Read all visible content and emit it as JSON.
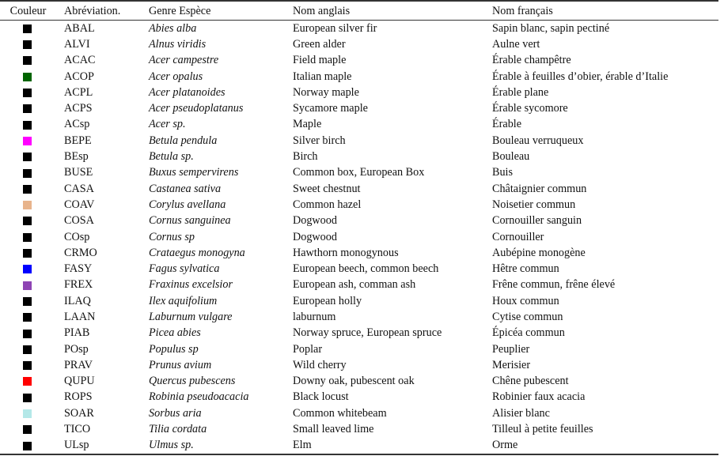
{
  "headers": {
    "color": "Couleur",
    "abbreviation": "Abréviation.",
    "genus_species": "Genre Espèce",
    "english_name": "Nom anglais",
    "french_name": "Nom français"
  },
  "rows": [
    {
      "color": "#000000",
      "abbr": "ABAL",
      "genus": "Abies alba",
      "en": "European silver fir",
      "fr": "Sapin blanc, sapin pectiné"
    },
    {
      "color": "#000000",
      "abbr": "ALVI",
      "genus": "Alnus viridis",
      "en": "Green alder",
      "fr": "Aulne vert"
    },
    {
      "color": "#000000",
      "abbr": "ACAC",
      "genus": "Acer campestre",
      "en": "Field maple",
      "fr": "Érable champêtre"
    },
    {
      "color": "#006400",
      "abbr": "ACOP",
      "genus": "Acer opalus",
      "en": "Italian maple",
      "fr": "Érable à feuilles d’obier, érable d’Italie"
    },
    {
      "color": "#000000",
      "abbr": "ACPL",
      "genus": "Acer platanoides",
      "en": "Norway maple",
      "fr": "Érable plane"
    },
    {
      "color": "#000000",
      "abbr": "ACPS",
      "genus": "Acer pseudoplatanus",
      "en": "Sycamore maple",
      "fr": "Érable sycomore"
    },
    {
      "color": "#000000",
      "abbr": "ACsp",
      "genus": "Acer sp.",
      "en": "Maple",
      "fr": "Érable"
    },
    {
      "color": "#ff00ff",
      "abbr": "BEPE",
      "genus": "Betula pendula",
      "en": "Silver birch",
      "fr": "Bouleau verruqueux"
    },
    {
      "color": "#000000",
      "abbr": "BEsp",
      "genus": "Betula sp.",
      "en": "Birch",
      "fr": "Bouleau"
    },
    {
      "color": "#000000",
      "abbr": "BUSE",
      "genus": "Buxus sempervirens",
      "en": "Common box, European Box",
      "fr": "Buis"
    },
    {
      "color": "#000000",
      "abbr": "CASA",
      "genus": "Castanea sativa",
      "en": "Sweet chestnut",
      "fr": "Châtaignier commun"
    },
    {
      "color": "#e8b48c",
      "abbr": "COAV",
      "genus": "Corylus avellana",
      "en": "Common hazel",
      "fr": "Noisetier commun"
    },
    {
      "color": "#000000",
      "abbr": "COSA",
      "genus": "Cornus sanguinea",
      "en": "Dogwood",
      "fr": "Cornouiller sanguin"
    },
    {
      "color": "#000000",
      "abbr": "COsp",
      "genus": "Cornus sp",
      "en": "Dogwood",
      "fr": "Cornouiller"
    },
    {
      "color": "#000000",
      "abbr": "CRMO",
      "genus": "Crataegus monogyna",
      "en": "Hawthorn monogynous",
      "fr": "Aubépine monogène"
    },
    {
      "color": "#0000ff",
      "abbr": "FASY",
      "genus": "Fagus sylvatica",
      "en": "European beech, common beech",
      "fr": "Hêtre commun"
    },
    {
      "color": "#8e44b4",
      "abbr": "FREX",
      "genus": "Fraxinus excelsior",
      "en": "European ash, comman ash",
      "fr": "Frêne commun, frêne élevé"
    },
    {
      "color": "#000000",
      "abbr": "ILAQ",
      "genus": "Ilex aquifolium",
      "en": "European holly",
      "fr": "Houx commun"
    },
    {
      "color": "#000000",
      "abbr": "LAAN",
      "genus": "Laburnum vulgare",
      "en": "laburnum",
      "fr": "Cytise commun"
    },
    {
      "color": "#000000",
      "abbr": "PIAB",
      "genus": "Picea abies",
      "en": "Norway spruce, European spruce",
      "fr": "Épicéa commun"
    },
    {
      "color": "#000000",
      "abbr": "POsp",
      "genus": "Populus sp",
      "en": "Poplar",
      "fr": "Peuplier"
    },
    {
      "color": "#000000",
      "abbr": "PRAV",
      "genus": "Prunus avium",
      "en": "Wild cherry",
      "fr": "Merisier"
    },
    {
      "color": "#ff0000",
      "abbr": "QUPU",
      "genus": "Quercus pubescens",
      "en": "Downy oak, pubescent oak",
      "fr": "Chêne pubescent"
    },
    {
      "color": "#000000",
      "abbr": "ROPS",
      "genus": "Robinia pseudoacacia",
      "en": "Black locust",
      "fr": "Robinier faux acacia"
    },
    {
      "color": "#b4e8e8",
      "abbr": "SOAR",
      "genus": "Sorbus aria",
      "en": "Common whitebeam",
      "fr": "Alisier blanc"
    },
    {
      "color": "#000000",
      "abbr": "TICO",
      "genus": "Tilia cordata",
      "en": "Small leaved lime",
      "fr": "Tilleul à petite feuilles"
    },
    {
      "color": "#000000",
      "abbr": "ULsp",
      "genus": "Ulmus sp.",
      "en": "Elm",
      "fr": "Orme"
    }
  ]
}
